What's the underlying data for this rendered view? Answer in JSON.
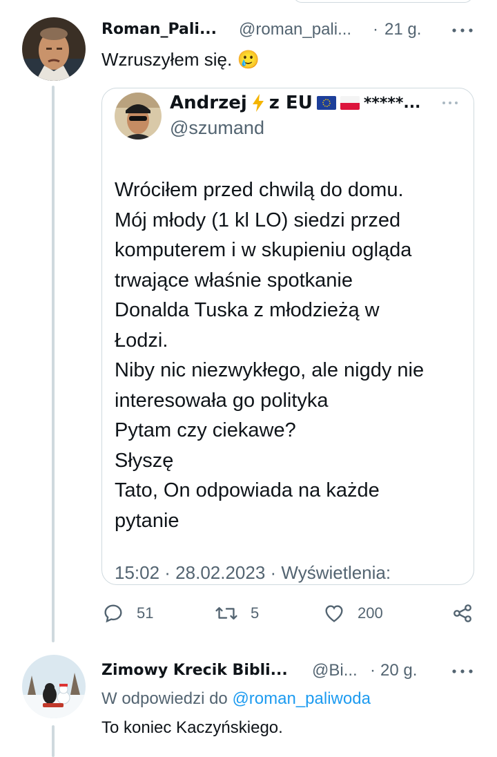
{
  "tweet1": {
    "display_name": "Roman_Pali...",
    "handle": "@roman_pali...",
    "separator": "·",
    "time": "21 g.",
    "text": "Wzruszyłem się.",
    "emoji": "🥲"
  },
  "quote": {
    "display_name": "Andrzej",
    "name_suffix": "z EU",
    "name_stars": "*****...",
    "handle": "@szumand",
    "lines": [
      "Wróciłem przed chwilą do domu.",
      "Mój młody (1 kl LO) siedzi przed",
      "komputerem i w skupieniu ogląda",
      "trwające właśnie spotkanie",
      "Donalda Tuska z młodzieżą w",
      "Łodzi.",
      "Niby nic niezwykłego, ale nigdy nie",
      "interesowała go polityka",
      "Pytam czy ciekawe?",
      "Słyszę",
      "Tato, On odpowiada na każde",
      "pytanie"
    ],
    "footer": "15:02 · 28.02.2023 · Wyświetlenia:"
  },
  "actions": {
    "replies": "51",
    "retweets": "5",
    "likes": "200"
  },
  "tweet2": {
    "display_name": "Zimowy Krecik Bibli...",
    "handle": "@Bi...",
    "separator": "·",
    "time": "20 g.",
    "reply_prefix": "W odpowiedzi do",
    "reply_handle": "@roman_paliwoda",
    "text": "To koniec Kaczyńskiego."
  },
  "colors": {
    "text": "#0f1419",
    "secondary": "#536471",
    "link": "#1d9bf0",
    "border": "#cfd9de"
  }
}
